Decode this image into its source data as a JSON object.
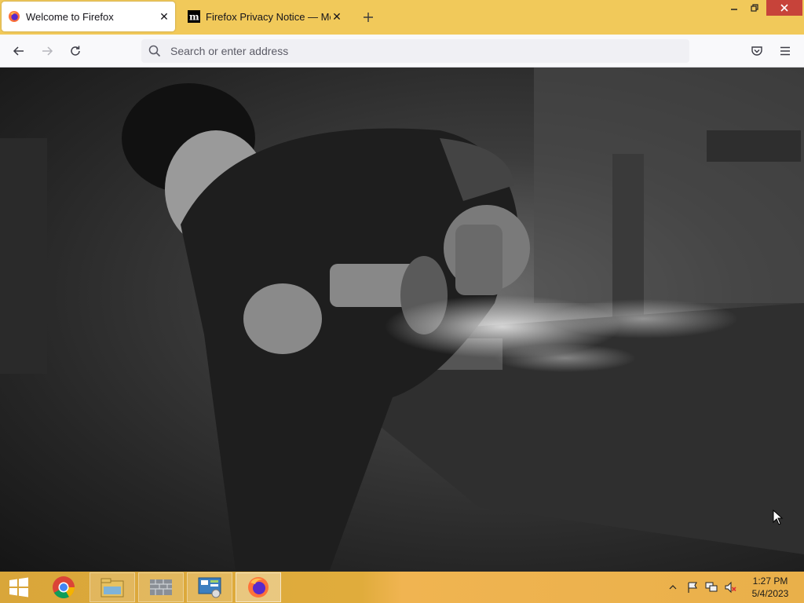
{
  "tabs": [
    {
      "title": "Welcome to Firefox",
      "active": true,
      "favicon": "firefox-icon"
    },
    {
      "title": "Firefox Privacy Notice — Mozilla",
      "active": false,
      "favicon": "mozilla-m-icon"
    }
  ],
  "navbar": {
    "back_icon": "back-arrow-icon",
    "forward_icon": "forward-arrow-icon",
    "reload_icon": "reload-icon",
    "address_placeholder": "Search or enter address",
    "address_value": "",
    "pocket_icon": "pocket-icon",
    "menu_icon": "hamburger-menu-icon"
  },
  "content": {
    "background": "monochrome photo of a person using an angle grinder with sparks"
  },
  "taskbar": {
    "apps": [
      "start-icon",
      "chrome-icon",
      "file-explorer-icon",
      "app-icon",
      "control-panel-icon",
      "firefox-icon"
    ],
    "time": "1:27 PM",
    "date": "5/4/2023"
  },
  "colors": {
    "tabstrip": "#f1c95a",
    "taskbar": "#e0ac3c",
    "close_button": "#c7433a"
  }
}
